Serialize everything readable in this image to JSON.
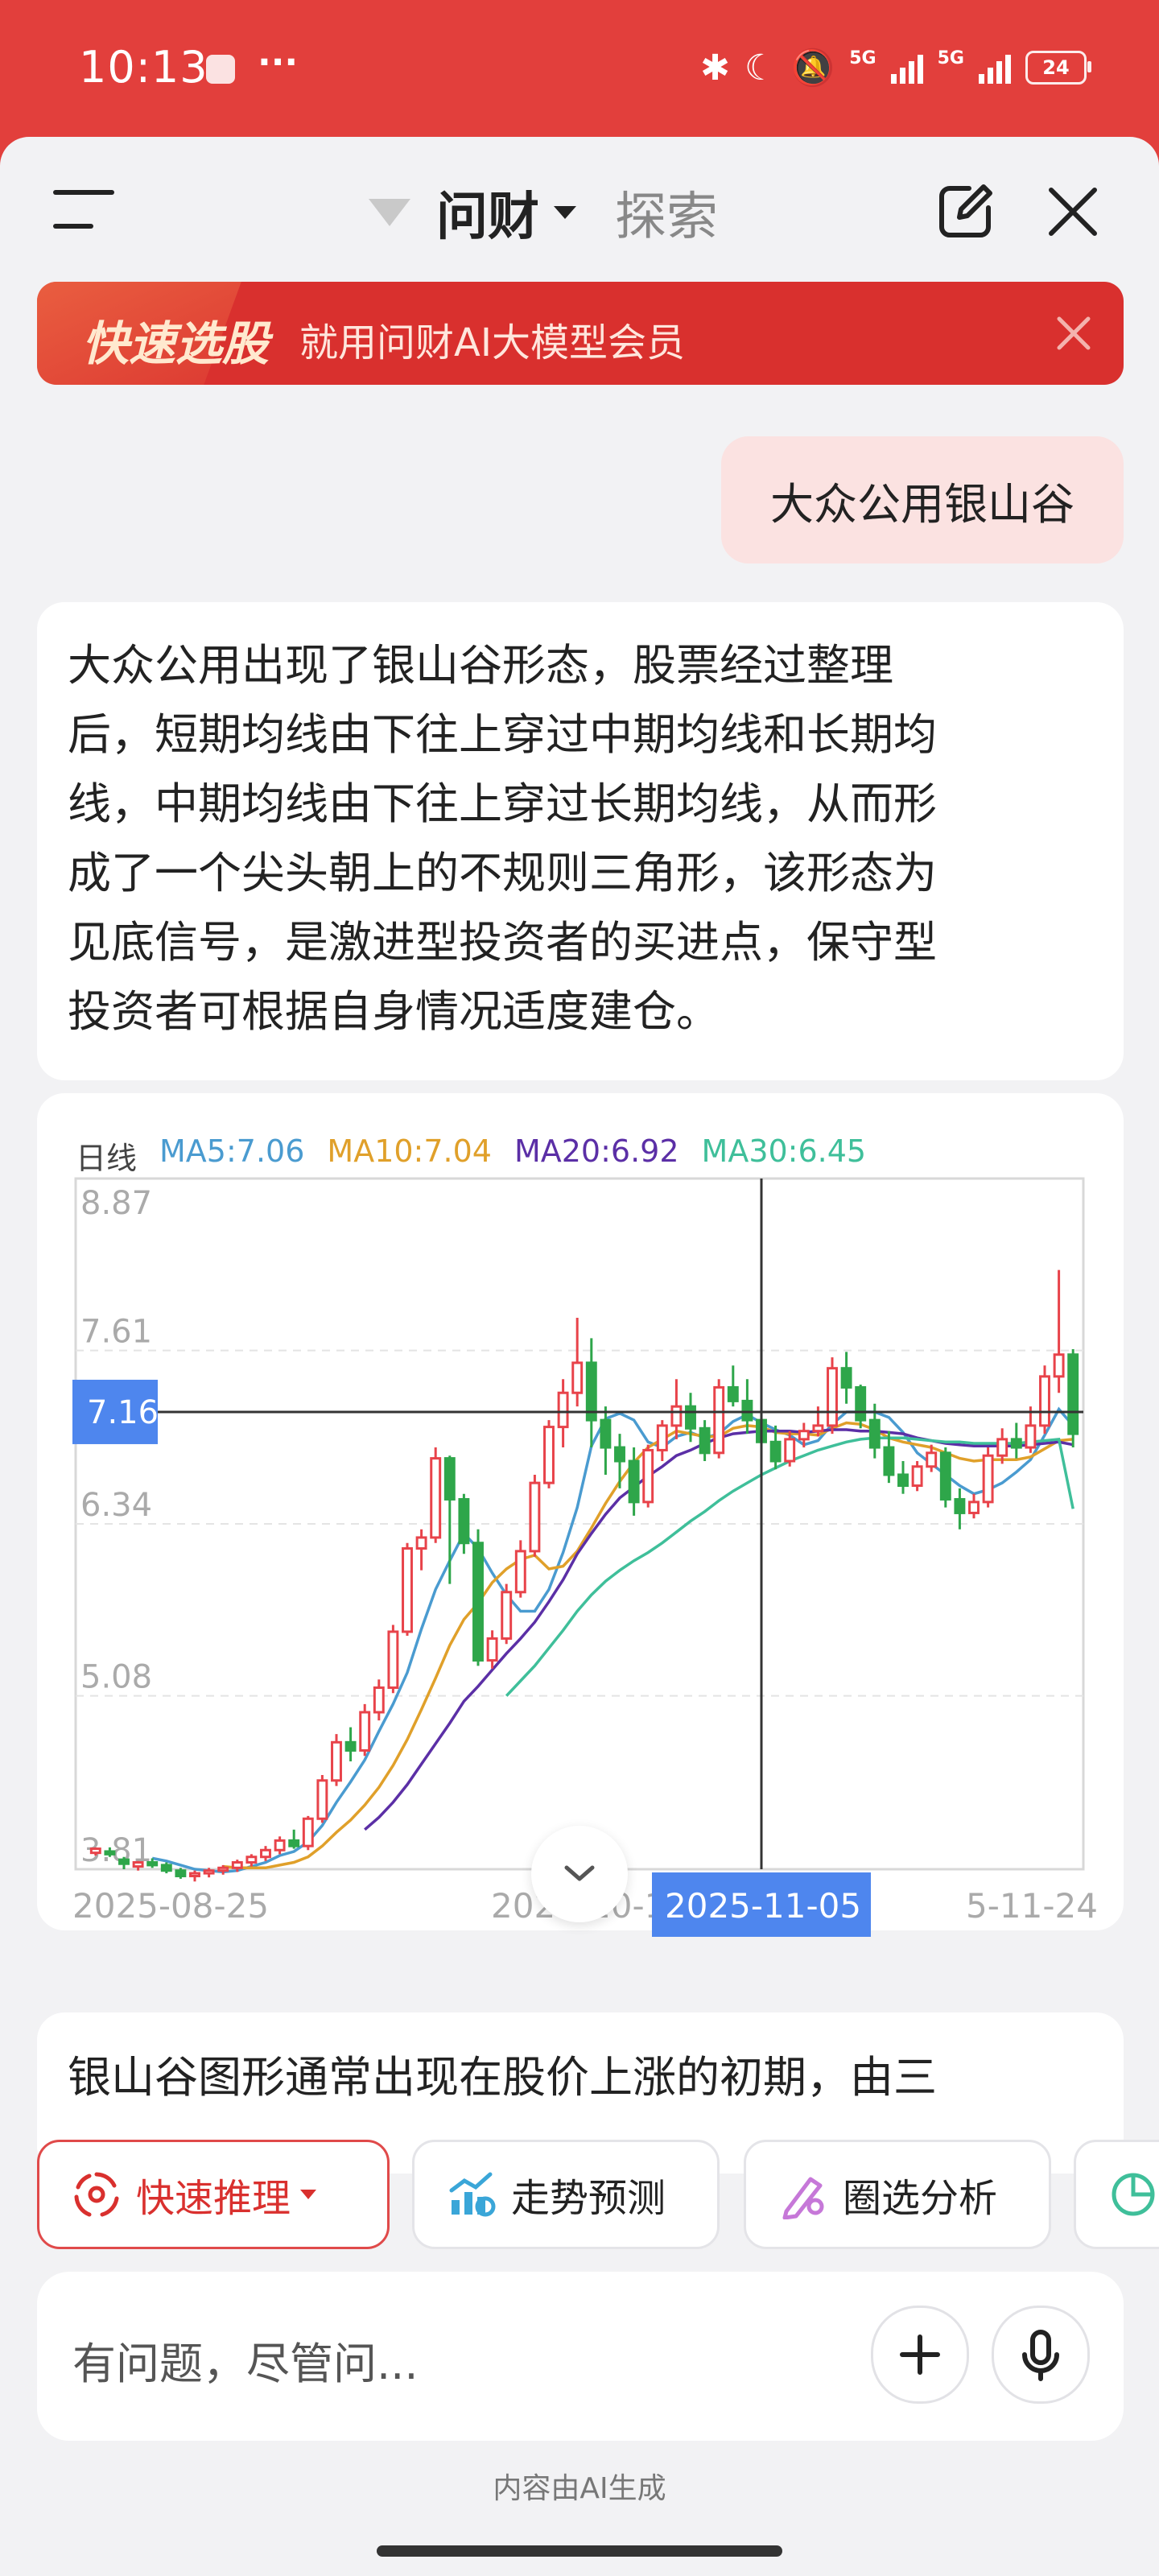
{
  "status_bar": {
    "time": "10:13",
    "dots": "···",
    "network_1": "5G",
    "network_2": "5G",
    "battery": "24"
  },
  "header": {
    "title": "问财",
    "explore": "探索"
  },
  "banner": {
    "tag": "快速选股",
    "text": "就用问财AI大模型会员"
  },
  "conversation": {
    "user_message": "大众公用银山谷",
    "answer_lines": [
      "大众公用出现了银山谷形态，股票经过整理",
      "后，短期均线由下往上穿过中期均线和长期均",
      "线，中期均线由下往上穿过长期均线，从而形",
      "成了一个尖头朝上的不规则三角形，该形态为",
      "见底信号，是激进型投资者的买进点，保守型",
      "投资者可根据自身情况适度建仓。"
    ],
    "second_answer_start": "银山谷图形通常出现在股价上涨的初期，由三"
  },
  "chart_data": {
    "type": "candlestick",
    "period_label": "日线",
    "legend": [
      {
        "name": "MA5",
        "value": "7.06",
        "color": "#4a9bd0"
      },
      {
        "name": "MA10",
        "value": "7.04",
        "color": "#e0a02a"
      },
      {
        "name": "MA20",
        "value": "6.92",
        "color": "#5b2fa6"
      },
      {
        "name": "MA30",
        "value": "6.45",
        "color": "#3fbf9a"
      }
    ],
    "y_ticks": [
      "8.87",
      "7.61",
      "6.34",
      "5.08",
      "3.81"
    ],
    "y_range": [
      3.81,
      8.87
    ],
    "x_labels": [
      "2025-08-25",
      "2025-10-14",
      "2025-11-05",
      "5-11-24"
    ],
    "crosshair": {
      "date": "2025-11-05",
      "price": "7.16"
    },
    "up_color": "#e8434a",
    "down_color": "#2ea64a",
    "candles": [
      [
        3.93,
        3.97,
        3.96,
        3.91
      ],
      [
        3.94,
        3.97,
        3.92,
        3.9
      ],
      [
        3.88,
        3.9,
        3.85,
        3.81
      ],
      [
        3.83,
        3.87,
        3.86,
        3.8
      ],
      [
        3.86,
        3.89,
        3.84,
        3.82
      ],
      [
        3.84,
        3.86,
        3.8,
        3.78
      ],
      [
        3.8,
        3.82,
        3.76,
        3.74
      ],
      [
        3.76,
        3.8,
        3.78,
        3.72
      ],
      [
        3.78,
        3.82,
        3.8,
        3.75
      ],
      [
        3.8,
        3.84,
        3.82,
        3.77
      ],
      [
        3.82,
        3.88,
        3.86,
        3.79
      ],
      [
        3.86,
        3.92,
        3.9,
        3.83
      ],
      [
        3.9,
        3.98,
        3.95,
        3.87
      ],
      [
        3.95,
        4.05,
        4.02,
        3.92
      ],
      [
        4.02,
        4.1,
        3.98,
        3.96
      ],
      [
        3.98,
        4.2,
        4.18,
        3.95
      ],
      [
        4.18,
        4.5,
        4.46,
        4.15
      ],
      [
        4.46,
        4.8,
        4.74,
        4.42
      ],
      [
        4.74,
        4.85,
        4.68,
        4.6
      ],
      [
        4.68,
        5.02,
        4.96,
        4.64
      ],
      [
        4.96,
        5.2,
        5.14,
        4.9
      ],
      [
        5.14,
        5.6,
        5.55,
        5.1
      ],
      [
        5.55,
        6.2,
        6.16,
        5.52
      ],
      [
        6.16,
        6.3,
        6.24,
        6.0
      ],
      [
        6.24,
        6.9,
        6.82,
        6.2
      ],
      [
        6.82,
        6.84,
        6.52,
        5.9
      ],
      [
        6.52,
        6.56,
        6.2,
        6.12
      ],
      [
        6.2,
        6.3,
        5.34,
        5.3
      ],
      [
        5.34,
        5.56,
        5.5,
        5.28
      ],
      [
        5.5,
        5.9,
        5.84,
        5.46
      ],
      [
        5.84,
        6.22,
        6.14,
        5.8
      ],
      [
        6.14,
        6.7,
        6.64,
        6.1
      ],
      [
        6.64,
        7.1,
        7.05,
        6.6
      ],
      [
        7.05,
        7.4,
        7.3,
        6.9
      ],
      [
        7.3,
        7.85,
        7.52,
        7.2
      ],
      [
        7.52,
        7.7,
        7.1,
        6.9
      ],
      [
        7.1,
        7.2,
        6.9,
        6.7
      ],
      [
        6.9,
        7.0,
        6.8,
        6.6
      ],
      [
        6.8,
        6.9,
        6.5,
        6.4
      ],
      [
        6.5,
        6.92,
        6.88,
        6.46
      ],
      [
        6.88,
        7.1,
        7.06,
        6.8
      ],
      [
        7.06,
        7.4,
        7.2,
        6.96
      ],
      [
        7.2,
        7.3,
        7.04,
        6.94
      ],
      [
        7.04,
        7.1,
        6.86,
        6.8
      ],
      [
        6.86,
        7.4,
        7.34,
        6.82
      ],
      [
        7.34,
        7.5,
        7.24,
        7.2
      ],
      [
        7.24,
        7.4,
        7.1,
        7.0
      ],
      [
        7.1,
        7.4,
        6.94,
        6.9
      ],
      [
        6.94,
        7.06,
        6.8,
        6.74
      ],
      [
        6.8,
        7.02,
        6.96,
        6.76
      ],
      [
        6.96,
        7.08,
        7.02,
        6.9
      ],
      [
        7.02,
        7.2,
        7.06,
        6.98
      ],
      [
        7.06,
        7.56,
        7.48,
        7.0
      ],
      [
        7.48,
        7.6,
        7.34,
        7.22
      ],
      [
        7.34,
        7.36,
        7.1,
        7.04
      ],
      [
        7.1,
        7.22,
        6.9,
        6.82
      ],
      [
        6.9,
        7.02,
        6.7,
        6.64
      ],
      [
        6.7,
        6.8,
        6.62,
        6.56
      ],
      [
        6.62,
        6.8,
        6.76,
        6.58
      ],
      [
        6.76,
        6.92,
        6.86,
        6.72
      ],
      [
        6.86,
        6.9,
        6.52,
        6.46
      ],
      [
        6.52,
        6.6,
        6.42,
        6.3
      ],
      [
        6.42,
        6.56,
        6.5,
        6.38
      ],
      [
        6.5,
        6.9,
        6.84,
        6.46
      ],
      [
        6.84,
        7.04,
        6.96,
        6.78
      ],
      [
        6.96,
        7.08,
        6.9,
        6.82
      ],
      [
        6.9,
        7.2,
        7.06,
        6.86
      ],
      [
        7.06,
        7.5,
        7.42,
        7.0
      ],
      [
        7.42,
        8.2,
        7.58,
        7.3
      ],
      [
        7.58,
        7.62,
        7.0,
        6.9
      ]
    ],
    "ma_lines": [
      {
        "name": "MA5",
        "values": [
          null,
          null,
          null,
          null,
          3.89,
          3.87,
          3.84,
          3.81,
          3.8,
          3.79,
          3.8,
          3.83,
          3.86,
          3.91,
          3.94,
          4.01,
          4.13,
          4.3,
          4.45,
          4.61,
          4.82,
          5.02,
          5.25,
          5.57,
          5.86,
          6.07,
          6.27,
          6.16,
          5.98,
          5.82,
          5.7,
          5.7,
          5.86,
          6.13,
          6.46,
          6.91,
          7.11,
          7.15,
          7.1,
          6.94,
          6.9,
          6.98,
          7.01,
          6.97,
          7.0,
          7.09,
          7.14,
          7.08,
          7.03,
          6.99,
          6.92,
          6.95,
          7.07,
          7.16,
          7.16,
          7.16,
          7.12,
          7.01,
          6.86,
          6.78,
          6.7,
          6.62,
          6.56,
          6.59,
          6.64,
          6.72,
          6.81,
          6.99,
          7.18,
          7.06
        ]
      },
      {
        "name": "MA10",
        "values": [
          null,
          null,
          null,
          null,
          null,
          null,
          null,
          null,
          null,
          3.83,
          3.82,
          3.82,
          3.82,
          3.84,
          3.86,
          3.9,
          3.98,
          4.08,
          4.17,
          4.28,
          4.41,
          4.57,
          4.76,
          4.98,
          5.21,
          5.45,
          5.64,
          5.76,
          5.91,
          6.01,
          6.08,
          6.11,
          6.01,
          6.03,
          6.14,
          6.31,
          6.49,
          6.65,
          6.79,
          6.9,
          6.96,
          7.02,
          7.0,
          6.98,
          6.98,
          7.04,
          7.06,
          7.05,
          7.01,
          7.0,
          7.0,
          6.99,
          7.04,
          7.08,
          7.07,
          7.03,
          6.97,
          6.94,
          6.92,
          6.9,
          6.86,
          6.82,
          6.8,
          6.81,
          6.81,
          6.81,
          6.83,
          6.89,
          6.95,
          6.96
        ]
      },
      {
        "name": "MA20",
        "values": [
          null,
          null,
          null,
          null,
          null,
          null,
          null,
          null,
          null,
          null,
          null,
          null,
          null,
          null,
          null,
          null,
          null,
          null,
          null,
          4.1,
          4.19,
          4.3,
          4.43,
          4.58,
          4.73,
          4.88,
          5.04,
          5.15,
          5.27,
          5.39,
          5.5,
          5.62,
          5.77,
          5.93,
          6.12,
          6.27,
          6.41,
          6.53,
          6.61,
          6.69,
          6.76,
          6.84,
          6.88,
          6.93,
          6.97,
          7.0,
          7.01,
          7.02,
          7.02,
          7.02,
          7.01,
          7.02,
          7.03,
          7.03,
          7.02,
          7.02,
          7.01,
          7.0,
          6.97,
          6.95,
          6.93,
          6.92,
          6.91,
          6.91,
          6.91,
          6.91,
          6.92,
          6.93,
          6.94,
          6.92
        ]
      },
      {
        "name": "MA30",
        "values": [
          null,
          null,
          null,
          null,
          null,
          null,
          null,
          null,
          null,
          null,
          null,
          null,
          null,
          null,
          null,
          null,
          null,
          null,
          null,
          null,
          null,
          null,
          null,
          null,
          null,
          null,
          null,
          null,
          null,
          5.08,
          5.19,
          5.3,
          5.43,
          5.56,
          5.7,
          5.82,
          5.92,
          6.0,
          6.07,
          6.13,
          6.2,
          6.28,
          6.36,
          6.43,
          6.51,
          6.58,
          6.64,
          6.7,
          6.75,
          6.8,
          6.84,
          6.88,
          6.91,
          6.94,
          6.96,
          6.97,
          6.97,
          6.97,
          6.96,
          6.95,
          6.94,
          6.94,
          6.93,
          6.93,
          6.93,
          6.93,
          6.94,
          6.95,
          6.96,
          6.45
        ]
      }
    ]
  },
  "toolbar": {
    "chips": [
      "快速推理",
      "走势预测",
      "圈选分析"
    ]
  },
  "input": {
    "placeholder": "有问题，尽管问..."
  },
  "footer": {
    "note": "内容由AI生成"
  }
}
